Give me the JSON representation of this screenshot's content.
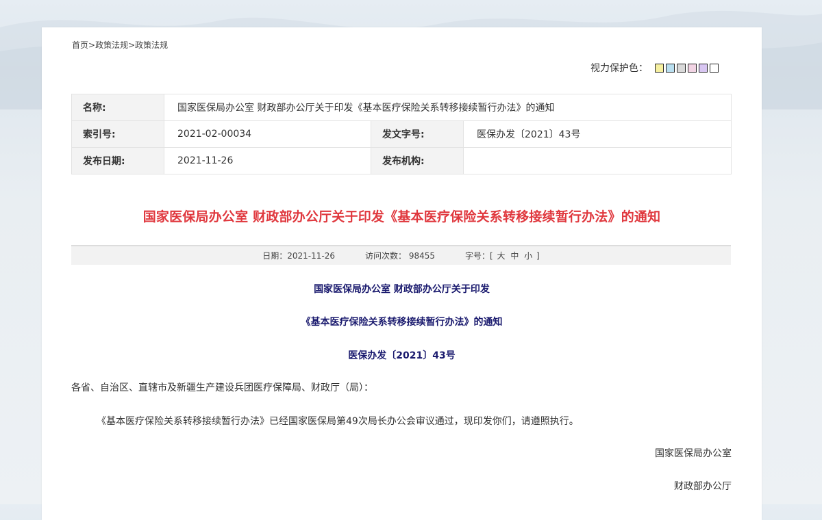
{
  "breadcrumb": {
    "home": "首页",
    "sep1": ">",
    "section": "政策法规",
    "sep2": ">",
    "current": "政策法规"
  },
  "eye_care": {
    "label": "视力保护色：",
    "colors": [
      "#f6f0a0",
      "#b9dff0",
      "#d9d9d9",
      "#f2d4e4",
      "#d8c6f2",
      "#ffffff"
    ]
  },
  "info": {
    "name_label": "名称:",
    "name_value": "国家医保局办公室 财政部办公厅关于印发《基本医疗保险关系转移接续暂行办法》的通知",
    "index_label": "索引号:",
    "index_value": "2021-02-00034",
    "docno_label": "发文字号:",
    "docno_value": "医保办发〔2021〕43号",
    "date_label": "发布日期:",
    "date_value": "2021-11-26",
    "org_label": "发布机构:",
    "org_value": ""
  },
  "title": "国家医保局办公室 财政部办公厅关于印发《基本医疗保险关系转移接续暂行办法》的通知",
  "meta": {
    "date": "日期：2021-11-26",
    "visits": "访问次数： 98455",
    "font_label": "字号：[",
    "font_large": "大",
    "font_medium": "中",
    "font_small": "小",
    "font_close": "]"
  },
  "body": {
    "heading1": "国家医保局办公室  财政部办公厅关于印发",
    "heading2": "《基本医疗保险关系转移接续暂行办法》的通知",
    "doc_number": "医保办发〔2021〕43号",
    "salutation": "各省、自治区、直辖市及新疆生产建设兵团医疗保障局、财政厅（局）：",
    "paragraph": "《基本医疗保险关系转移接续暂行办法》已经国家医保局第49次局长办公会审议通过，现印发你们，请遵照执行。",
    "signer1": "国家医保局办公室",
    "signer2": "财政部办公厅"
  }
}
